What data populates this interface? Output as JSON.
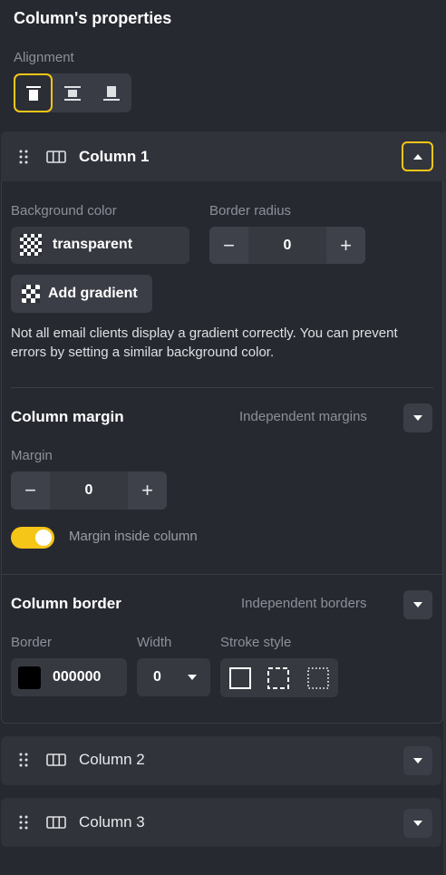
{
  "panel_title": "Column's properties",
  "alignment": {
    "label": "Alignment",
    "options": [
      {
        "icon": "align-top-icon",
        "active": true
      },
      {
        "icon": "align-middle-icon",
        "active": false
      },
      {
        "icon": "align-bottom-icon",
        "active": false
      }
    ]
  },
  "accent_color": "#f5c518",
  "columns": [
    {
      "label": "Column 1",
      "expanded": true
    },
    {
      "label": "Column 2",
      "expanded": false
    },
    {
      "label": "Column 3",
      "expanded": false
    }
  ],
  "background": {
    "label": "Background color",
    "value": "transparent",
    "swatch_icon": "checkerboard-icon"
  },
  "border_radius": {
    "label": "Border radius",
    "value": "0",
    "minus": "−",
    "plus": "+"
  },
  "gradient": {
    "button_label": "Add gradient",
    "note": "Not all email clients display a gradient correctly. You can prevent errors by setting a similar background color."
  },
  "margin_section": {
    "title": "Column margin",
    "mode_label": "Independent margins",
    "margin_label": "Margin",
    "margin_value": "0",
    "minus": "−",
    "plus": "+",
    "toggle_label": "Margin inside column",
    "toggle_on": true
  },
  "border_section": {
    "title": "Column border",
    "mode_label": "Independent borders",
    "border_label": "Border",
    "border_color_value": "000000",
    "border_color": "#000000",
    "width_label": "Width",
    "width_value": "0",
    "stroke_label": "Stroke style",
    "stroke_options": [
      "solid-stroke-icon",
      "dashed-stroke-icon",
      "dotted-stroke-icon"
    ]
  }
}
